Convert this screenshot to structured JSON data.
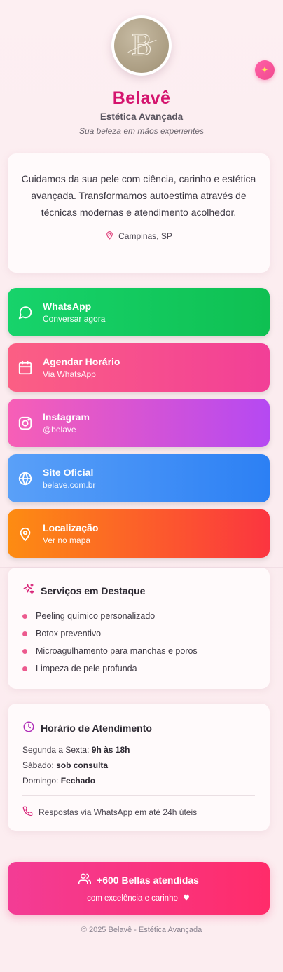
{
  "header": {
    "brand": "Belavê",
    "subtitle": "Estética Avançada",
    "tagline": "Sua beleza em mãos experientes",
    "logo_letter": "B"
  },
  "about": {
    "text": "Cuidamos da sua pele com ciência, carinho e estética avançada. Transformamos autoestima através de técnicas modernas e atendimento acolhedor.",
    "location": "Campinas, SP"
  },
  "links": [
    {
      "title": "WhatsApp",
      "sub": "Conversar agora",
      "icon": "chat-icon"
    },
    {
      "title": "Agendar Horário",
      "sub": "Via WhatsApp",
      "icon": "calendar-icon"
    },
    {
      "title": "Instagram",
      "sub": "@belave",
      "icon": "instagram-icon"
    },
    {
      "title": "Site Oficial",
      "sub": "belave.com.br",
      "icon": "globe-icon"
    },
    {
      "title": "Localização",
      "sub": "Ver no mapa",
      "icon": "map-pin-icon"
    }
  ],
  "services": {
    "title": "Serviços em Destaque",
    "items": [
      "Peeling químico personalizado",
      "Botox preventivo",
      "Microagulhamento para manchas e poros",
      "Limpeza de pele profunda"
    ]
  },
  "hours": {
    "title": "Horário de Atendimento",
    "rows": [
      {
        "label": "Segunda a Sexta:",
        "value": "9h às 18h"
      },
      {
        "label": "Sábado:",
        "value": "sob consulta"
      },
      {
        "label": "Domingo:",
        "value": "Fechado"
      }
    ],
    "reply": "Respostas via WhatsApp em até 24h úteis"
  },
  "stats": {
    "headline": "+600 Bellas atendidas",
    "sub": "com excelência e carinho"
  },
  "footer": "© 2025 Belavê - Estética Avançada",
  "colors": {
    "brand": "#d4146e",
    "whatsapp": "#17d36b",
    "schedule": "#f23f97",
    "instagram": "#b549f2",
    "site": "#2c80f4",
    "location": "#fb3540"
  }
}
